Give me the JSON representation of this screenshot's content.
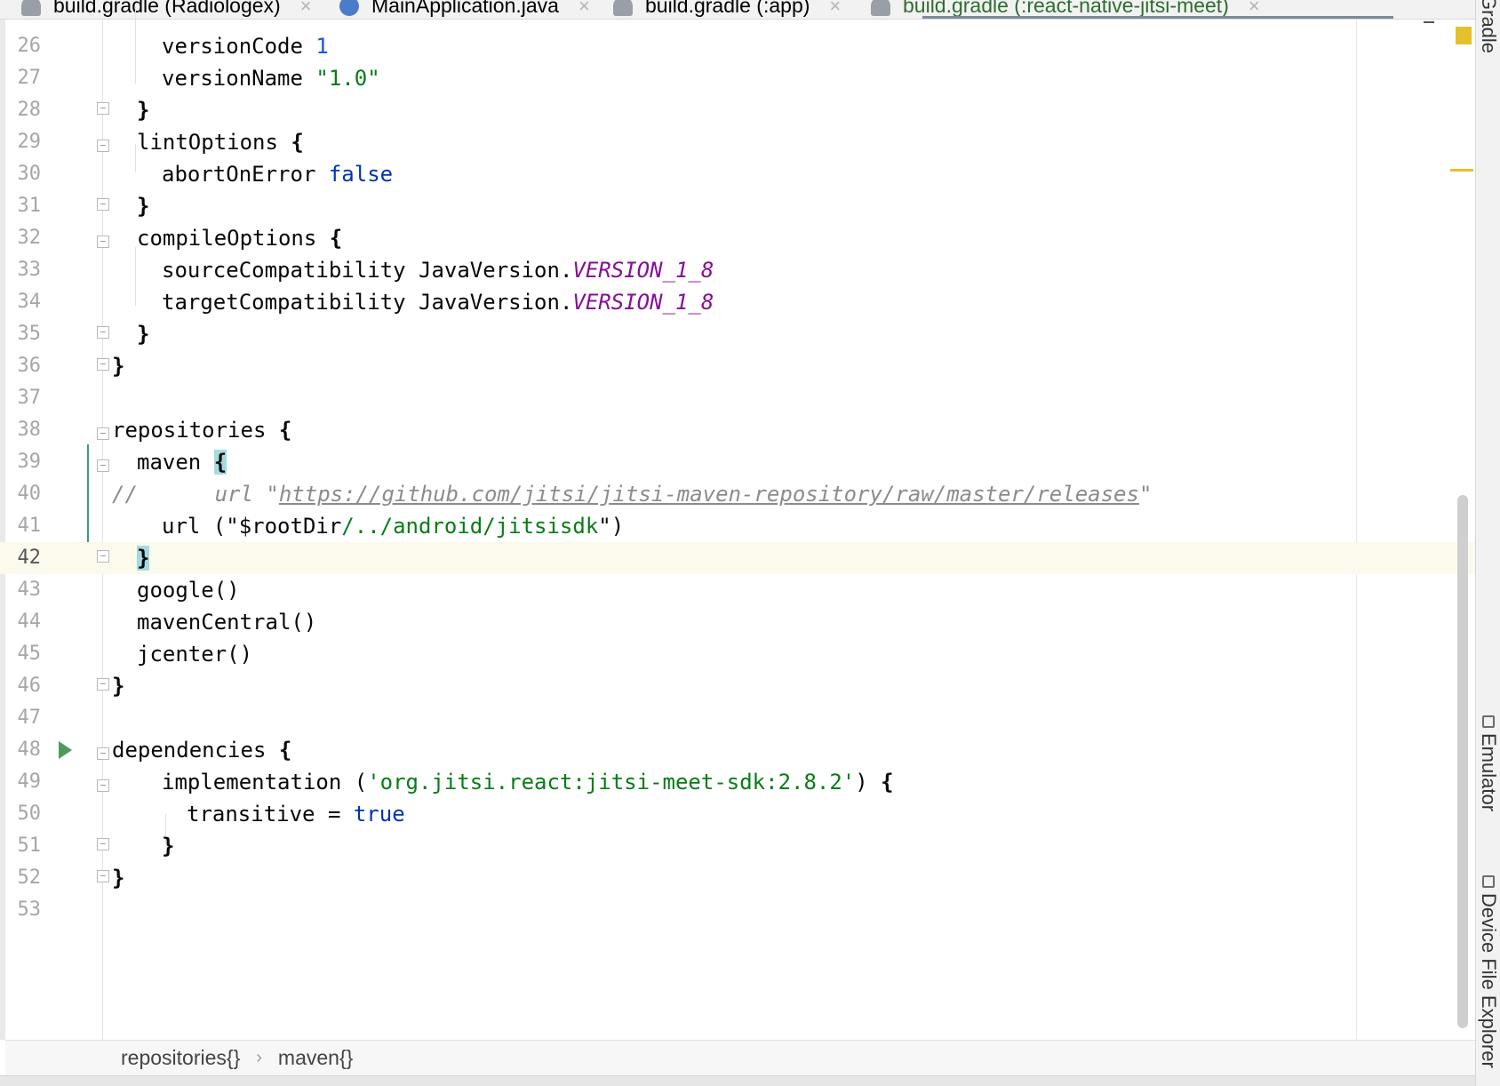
{
  "tabs": [
    {
      "label": "build.gradle (Radiologex)",
      "icon": "gradle-icon",
      "active": false
    },
    {
      "label": "MainApplication.java",
      "icon": "java-class-icon",
      "active": false
    },
    {
      "label": "build.gradle (:app)",
      "icon": "gradle-icon",
      "active": false
    },
    {
      "label": "build.gradle (:react-native-jitsi-meet)",
      "icon": "gradle-icon",
      "active": true
    }
  ],
  "editor": {
    "lines": {
      "26": "26",
      "27": "27",
      "28": "28",
      "29": "29",
      "30": "30",
      "31": "31",
      "32": "32",
      "33": "33",
      "34": "34",
      "35": "35",
      "36": "36",
      "37": "37",
      "38": "38",
      "39": "39",
      "40": "40",
      "41": "41",
      "42": "42",
      "43": "43",
      "44": "44",
      "45": "45",
      "46": "46",
      "47": "47",
      "48": "48",
      "49": "49",
      "50": "50",
      "51": "51",
      "52": "52",
      "53": "53"
    },
    "current_line": "42",
    "tokens": {
      "versionCode": "versionCode",
      "versionCode_val": "1",
      "versionName": "versionName",
      "versionName_val": "\"1.0\"",
      "lintOptions": "lintOptions",
      "abortOnError": "abortOnError",
      "false": "false",
      "compileOptions": "compileOptions",
      "sourceCompatibility": "sourceCompatibility",
      "targetCompatibility": "targetCompatibility",
      "javaVersion": "JavaVersion.",
      "version_1_8": "VERSION_1_8",
      "repositories": "repositories",
      "maven": "maven",
      "comment_prefix": "//      url \"",
      "comment_url": "https://github.com/jitsi/jitsi-maven-repository/raw/master/releases",
      "comment_suffix": "\"",
      "url_open": "url (\"$rootDir",
      "url_path": "/../android/jitsisdk",
      "url_close": "\")",
      "google": "google()",
      "mavenCentral": "mavenCentral()",
      "jcenter": "jcenter()",
      "dependencies": "dependencies",
      "implementation": "implementation (",
      "impl_str": "'org.jitsi.react:jitsi-meet-sdk:2.8.2'",
      "impl_close": ") ",
      "transitive": "transitive = ",
      "true": "true",
      "open_brace": "{",
      "close_brace": "}"
    }
  },
  "breadcrumb": {
    "items": [
      "repositories{}",
      "maven{}"
    ],
    "separator": "›"
  },
  "tool_windows": [
    "Gradle",
    "Emulator",
    "Device File Explorer"
  ],
  "colors": {
    "keyword": "#0033b3",
    "number": "#1750eb",
    "string": "#067d17",
    "constant": "#871094",
    "comment": "#8c8c8c",
    "current_line": "#fcfaed",
    "brace_match": "#a5dbe0",
    "marker": "#e6c02a",
    "run": "#4a9d5b"
  }
}
